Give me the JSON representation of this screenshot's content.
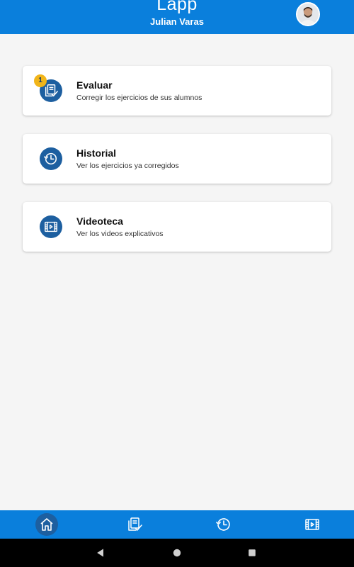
{
  "header": {
    "app_title": "Lapp",
    "user_name": "Julian Varas",
    "avatar_icon": "profile-photo"
  },
  "cards": [
    {
      "title": "Evaluar",
      "subtitle": "Corregir los ejercicios de sus alumnos",
      "icon": "evaluate-icon",
      "badge": "1"
    },
    {
      "title": "Historial",
      "subtitle": "Ver los ejercicios ya corregidos",
      "icon": "history-icon"
    },
    {
      "title": "Videoteca",
      "subtitle": "Ver los videos explicativos",
      "icon": "video-library-icon"
    }
  ],
  "bottom_nav": [
    {
      "icon": "home-icon",
      "active": true
    },
    {
      "icon": "evaluate-icon",
      "active": false
    },
    {
      "icon": "history-icon",
      "active": false
    },
    {
      "icon": "video-library-icon",
      "active": false
    }
  ],
  "system_nav": [
    "back-icon",
    "home-circle-icon",
    "recents-icon"
  ],
  "colors": {
    "primary": "#0a7fdc",
    "icon_circle": "#1d5fa0",
    "badge": "#f1b51a",
    "background": "#f5f5f5"
  }
}
